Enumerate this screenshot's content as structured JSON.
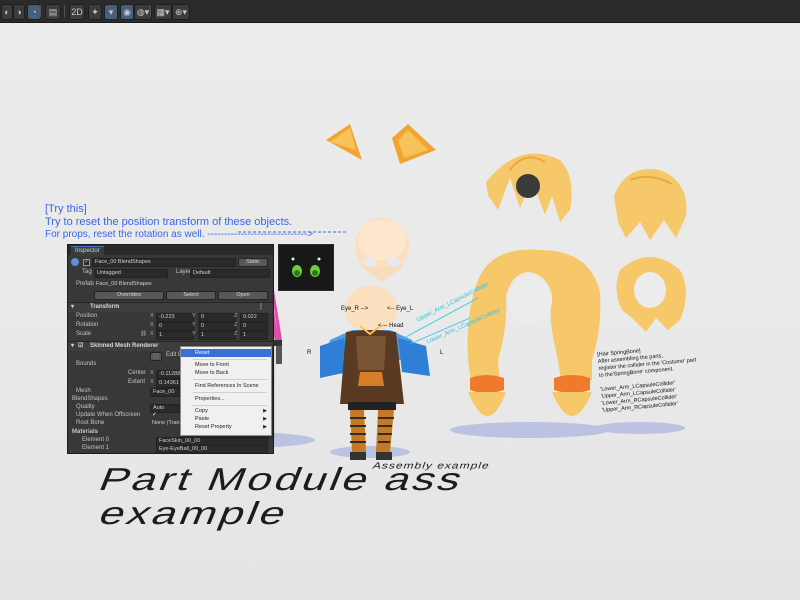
{
  "toolbar": {
    "tools": [
      {
        "label": "◐"
      },
      {
        "label": "◑"
      },
      {
        "label": "◔"
      },
      {
        "label": "▤"
      },
      {
        "label": "2D"
      },
      {
        "label": "✦"
      },
      {
        "label": "▾"
      },
      {
        "label": "◉"
      },
      {
        "label": "◍▾"
      },
      {
        "label": "▦▾"
      },
      {
        "label": "⊕▾"
      }
    ]
  },
  "hint": {
    "line1": "[Try this]",
    "line2": "Try to reset the position transform of these objects.",
    "line3": "For props, reset the rotation as well. ------------------------------>"
  },
  "inspector": {
    "tab": "Inspector",
    "object_name": "Face_00 BlendShapes",
    "static_label": "Static",
    "tag_label": "Tag",
    "tag_value": "Untagged",
    "layer_label": "Layer",
    "layer_value": "Default",
    "prefab_label": "Prefab",
    "prefab_value": "Face_00 BlendShapes",
    "overrides": "Overrides",
    "select": "Select",
    "open": "Open",
    "transform": {
      "title": "Transform",
      "position_label": "Position",
      "position": {
        "x": "-0.223",
        "y": "0",
        "z": "0.022"
      },
      "rotation_label": "Rotation",
      "rotation": {
        "x": "0",
        "y": "0",
        "z": "0"
      },
      "scale_label": "Scale",
      "scale": {
        "x": "1",
        "y": "1",
        "z": "1"
      }
    },
    "smr": {
      "title": "Skinned Mesh Renderer",
      "edit_bounds": "Edit Bo",
      "bounds_label": "Bounds",
      "center_label": "Center",
      "center_x": "-0.11288",
      "extent_label": "Extent",
      "extent_x": "0.14361",
      "mesh_label": "Mesh",
      "mesh_value": "Face_00",
      "blendshapes_label": "BlendShapes",
      "quality_label": "Quality",
      "quality_value": "Auto",
      "update_offscreen_label": "Update When Offscreen",
      "update_offscreen_check": "✓",
      "root_bone_label": "Root Bone",
      "root_bone_value": "None (Trans"
    },
    "materials": {
      "title": "Materials",
      "rows": [
        {
          "label": "Element 0",
          "value": "FaceSkin_00_00"
        },
        {
          "label": "Element 1",
          "value": "Eye-EyeBall_00_00"
        }
      ]
    }
  },
  "context_menu": {
    "items": [
      {
        "label": "Reset",
        "highlighted": true,
        "submenu": false
      },
      {
        "label": "Move to Front",
        "highlighted": false,
        "submenu": false
      },
      {
        "label": "Move to Back",
        "highlighted": false,
        "submenu": false
      },
      {
        "label": "Find References In Scene",
        "highlighted": false,
        "submenu": false
      },
      {
        "label": "Properties...",
        "highlighted": false,
        "submenu": false
      },
      {
        "label": "Copy",
        "highlighted": false,
        "submenu": true
      },
      {
        "label": "Paste",
        "highlighted": false,
        "submenu": true
      },
      {
        "label": "Reset Property",
        "highlighted": false,
        "submenu": true
      }
    ]
  },
  "scene": {
    "eye_r": "Eye_R -->",
    "eye_l": "<-- Eye_L",
    "head": "<--- Head",
    "r_mark": "R",
    "l_mark": "L",
    "upper_arm_l": "Upper_Arm_LCapsuleCollider",
    "lower_arm_l": "Lower_Arm_LCapsuleCollider",
    "hair_note": [
      "[Hair SpringBone]",
      "After assembling the parts,",
      "register the collider in the 'Costume' part",
      "to the'SpringBone' component.",
      "",
      "'Lower_Arm_LCapsuleCollider'",
      "'Upper_Arm_LCapsuleCollider'",
      "'Lower_Arm_RCapsuleCollider'",
      "'Upper_Arm_RCapsuleCollider'"
    ],
    "subtitle": "Assembly example",
    "title_line1": "Part Module ass",
    "title_line2": "example"
  },
  "colors": {
    "hint_blue": "#3b66e4",
    "collider_cyan": "#29c6e6",
    "hair": "#f6c86a",
    "menu_highlight": "#3a6fd8",
    "arrow_red": "#c01010"
  }
}
